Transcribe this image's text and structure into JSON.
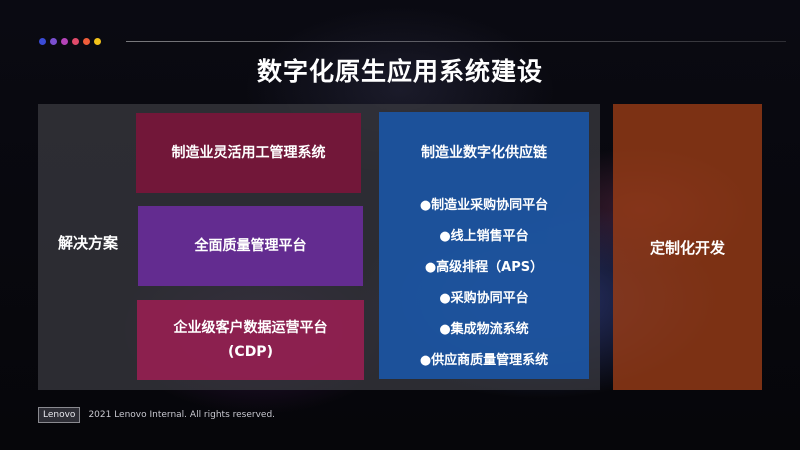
{
  "colors": {
    "dots": [
      "#3a4bd6",
      "#7a4fd0",
      "#b443b8",
      "#e04a6a",
      "#ef5d3a",
      "#f2c21a"
    ],
    "box_1": "#76163a",
    "box_2": "#662c96",
    "box_3": "#912050",
    "supply_chain": "#1a56a8",
    "custom_dev": "#963a16"
  },
  "slide": {
    "title": "数字化原生应用系统建设"
  },
  "diagram": {
    "left_label": "解决方案",
    "solutions": [
      {
        "line1": "制造业灵活用工管理系统",
        "line2": ""
      },
      {
        "line1": "全面质量管理平台",
        "line2": ""
      },
      {
        "line1": "企业级客户数据运营平台",
        "line2": "(CDP)"
      }
    ],
    "supply_chain": {
      "title": "制造业数字化供应链",
      "items": [
        "●制造业采购协同平台",
        "●线上销售平台",
        "●高级排程（APS）",
        "●采购协同平台",
        "●集成物流系统",
        "●供应商质量管理系统"
      ]
    },
    "custom_dev": "定制化开发"
  },
  "footer": {
    "logo": "Lenovo",
    "copyright": "2021 Lenovo Internal. All rights reserved."
  }
}
